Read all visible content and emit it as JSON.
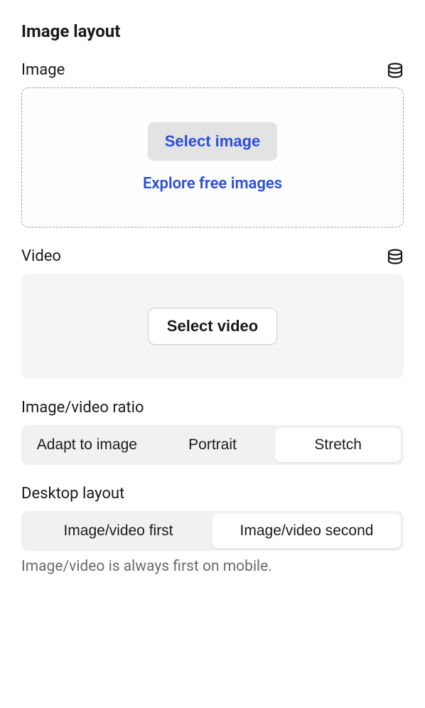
{
  "title": "Image layout",
  "image": {
    "label": "Image",
    "select_btn": "Select image",
    "explore_link": "Explore free images"
  },
  "video": {
    "label": "Video",
    "select_btn": "Select video"
  },
  "ratio": {
    "label": "Image/video ratio",
    "options": [
      "Adapt to image",
      "Portrait",
      "Stretch"
    ],
    "selected": "Stretch"
  },
  "layout": {
    "label": "Desktop layout",
    "options": [
      "Image/video first",
      "Image/video second"
    ],
    "selected": "Image/video second",
    "helper": "Image/video is always first on mobile."
  }
}
